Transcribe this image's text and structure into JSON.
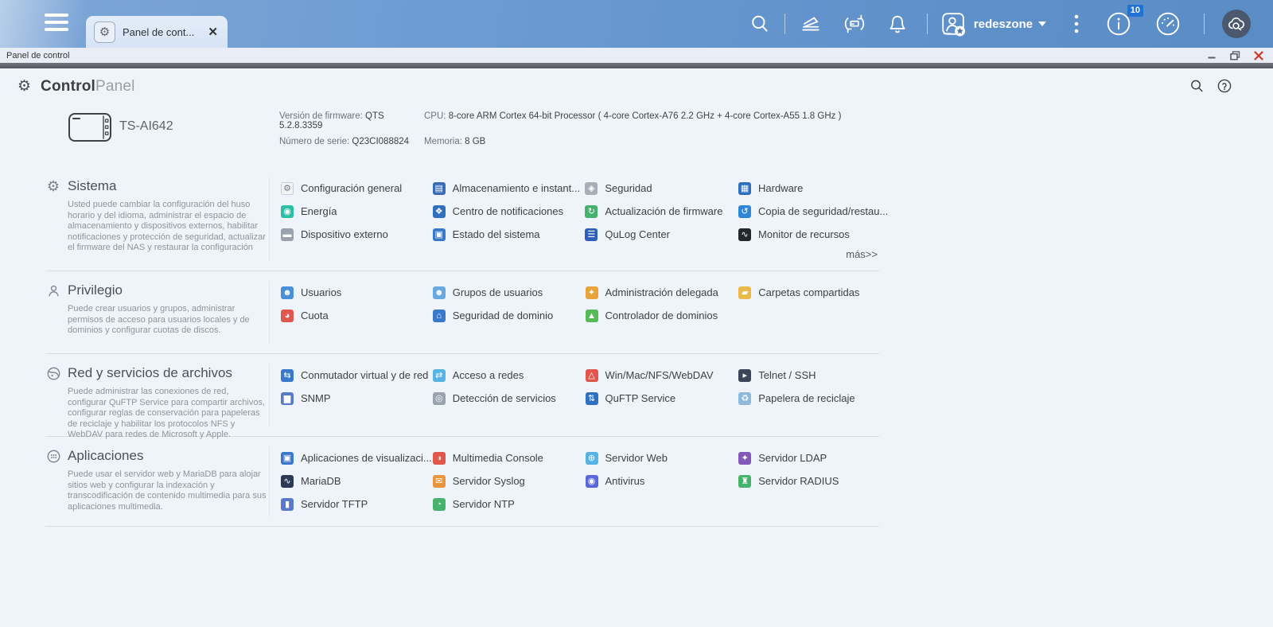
{
  "topbar": {
    "tab": {
      "label": "Panel de cont...",
      "icon": "gear-icon"
    },
    "user": {
      "name": "redeszone"
    },
    "info_badge": "10"
  },
  "window": {
    "title": "Panel de control"
  },
  "panel": {
    "title_bold": "Control",
    "title_light": "Panel"
  },
  "icons": {
    "gear_glyph": "⚙"
  },
  "device": {
    "model": "TS-AI642",
    "info": [
      {
        "label": "Versión de firmware:",
        "value": "QTS 5.2.8.3359"
      },
      {
        "label": "CPU:",
        "value": "8-core ARM Cortex 64-bit Processor ( 4-core Cortex-A76 2.2 GHz + 4-core Cortex-A55 1.8 GHz )"
      },
      {
        "label": "Número de serie:",
        "value": "Q23CI088824"
      },
      {
        "label": "Memoria:",
        "value": "8 GB"
      }
    ]
  },
  "sections": [
    {
      "id": "sistema",
      "title": "Sistema",
      "description": "Usted puede cambiar la configuración del huso horario y del idioma, administrar el espacio de almacenamiento y dispositivos externos, habilitar notificaciones y protección de seguridad, actualizar el firmware del NAS y restaurar la configuración",
      "more_label": "más>>",
      "columns": [
        [
          {
            "label": "Configuración general",
            "name": "link-configuracion-general",
            "icon": "general-settings-icon",
            "glyph": "⚙",
            "color": "#f2f4f6",
            "fg": "#6e7884",
            "bd": "#c6ccd4"
          },
          {
            "label": "Energía",
            "name": "link-energia",
            "icon": "power-bulb-icon",
            "glyph": "◉",
            "color": "#2dbfa4"
          },
          {
            "label": "Dispositivo externo",
            "name": "link-dispositivo-externo",
            "icon": "external-drive-icon",
            "glyph": "▬",
            "color": "#9aa3ad"
          }
        ],
        [
          {
            "label": "Almacenamiento e instant...",
            "name": "link-almacenamiento-instantaneas",
            "icon": "storage-snapshots-icon",
            "glyph": "▤",
            "color": "#3a6cb5"
          },
          {
            "label": "Centro de notificaciones",
            "name": "link-centro-notificaciones",
            "icon": "notification-center-icon",
            "glyph": "❖",
            "color": "#2f6fc0"
          },
          {
            "label": "Estado del sistema",
            "name": "link-estado-sistema",
            "icon": "system-status-icon",
            "glyph": "▣",
            "color": "#3a78c9"
          }
        ],
        [
          {
            "label": "Seguridad",
            "name": "link-seguridad",
            "icon": "security-lock-icon",
            "glyph": "◈",
            "color": "#a8aeb8"
          },
          {
            "label": "Actualización de firmware",
            "name": "link-actualizacion-firmware",
            "icon": "firmware-update-icon",
            "glyph": "↻",
            "color": "#45b36b"
          },
          {
            "label": "QuLog Center",
            "name": "link-qulog-center",
            "icon": "qulog-center-icon",
            "glyph": "☰",
            "color": "#2e5fb8"
          }
        ],
        [
          {
            "label": "Hardware",
            "name": "link-hardware",
            "icon": "hardware-chip-icon",
            "glyph": "▦",
            "color": "#2e6fbe"
          },
          {
            "label": "Copia de seguridad/restau...",
            "name": "link-copia-seguridad",
            "icon": "backup-restore-icon",
            "glyph": "↺",
            "color": "#2f86d6"
          },
          {
            "label": "Monitor de recursos",
            "name": "link-monitor-recursos",
            "icon": "resource-monitor-icon",
            "glyph": "∿",
            "color": "#23272e"
          }
        ]
      ]
    },
    {
      "id": "privilegio",
      "title": "Privilegio",
      "description": "Puede crear usuarios y grupos, administrar permisos de acceso para usuarios locales y de dominios y configurar cuotas de discos.",
      "columns": [
        [
          {
            "label": "Usuarios",
            "name": "link-usuarios",
            "icon": "user-icon",
            "glyph": "☻",
            "color": "#4a90d9"
          },
          {
            "label": "Cuota",
            "name": "link-cuota",
            "icon": "quota-pie-icon",
            "glyph": "◕",
            "color": "#e2574c"
          }
        ],
        [
          {
            "label": "Grupos de usuarios",
            "name": "link-grupos-usuarios",
            "icon": "user-groups-icon",
            "glyph": "☻",
            "color": "#6aa9e0"
          },
          {
            "label": "Seguridad de dominio",
            "name": "link-seguridad-dominio",
            "icon": "domain-security-icon",
            "glyph": "⌂",
            "color": "#3a78c9"
          }
        ],
        [
          {
            "label": "Administración delegada",
            "name": "link-administracion-delegada",
            "icon": "delegated-admin-icon",
            "glyph": "✦",
            "color": "#e8a33d"
          },
          {
            "label": "Controlador de dominios",
            "name": "link-controlador-dominios",
            "icon": "domain-controller-icon",
            "glyph": "▲",
            "color": "#58b957"
          }
        ],
        [
          {
            "label": "Carpetas compartidas",
            "name": "link-carpetas-compartidas",
            "icon": "shared-folders-icon",
            "glyph": "▰",
            "color": "#e9b949"
          }
        ]
      ]
    },
    {
      "id": "red-servicios",
      "title": "Red y servicios de archivos",
      "description": "Puede administrar las conexiones de red, configurar QuFTP Service para compartir archivos, configurar reglas de conservación para papeleras de reciclaje y habilitar los protocolos NFS y WebDAV para redes de Microsoft y Apple.",
      "columns": [
        [
          {
            "label": "Conmutador virtual y de red",
            "name": "link-conmutador-virtual",
            "icon": "virtual-switch-icon",
            "glyph": "⇆",
            "color": "#3a78c9"
          },
          {
            "label": "SNMP",
            "name": "link-snmp",
            "icon": "snmp-chart-icon",
            "glyph": "▆",
            "color": "#5b79c9"
          }
        ],
        [
          {
            "label": "Acceso a redes",
            "name": "link-acceso-redes",
            "icon": "network-access-icon",
            "glyph": "⇄",
            "color": "#57b3e3"
          },
          {
            "label": "Detección de servicios",
            "name": "link-deteccion-servicios",
            "icon": "service-discovery-icon",
            "glyph": "◎",
            "color": "#9aa3ad"
          }
        ],
        [
          {
            "label": "Win/Mac/NFS/WebDAV",
            "name": "link-win-mac-nfs-webdav",
            "icon": "protocols-icon",
            "glyph": "△",
            "color": "#e2574c"
          },
          {
            "label": "QuFTP Service",
            "name": "link-quftp-service",
            "icon": "quftp-icon",
            "glyph": "⇅",
            "color": "#2f6fc0"
          }
        ],
        [
          {
            "label": "Telnet / SSH",
            "name": "link-telnet-ssh",
            "icon": "terminal-icon",
            "glyph": "▸",
            "color": "#3b4757"
          },
          {
            "label": "Papelera de reciclaje",
            "name": "link-papelera-reciclaje",
            "icon": "recycle-bin-icon",
            "glyph": "♻",
            "color": "#8fb8dd"
          }
        ]
      ]
    },
    {
      "id": "aplicaciones",
      "title": "Aplicaciones",
      "description": "Puede usar el servidor web y MariaDB para alojar sitios web y configurar la indexación y transcodificación de contenido multimedia para sus aplicaciones multimedia.",
      "columns": [
        [
          {
            "label": "Aplicaciones de visualizaci...",
            "name": "link-aplicaciones-visualizacion",
            "icon": "display-apps-icon",
            "glyph": "▣",
            "color": "#3a78c9"
          },
          {
            "label": "MariaDB",
            "name": "link-mariadb",
            "icon": "mariadb-icon",
            "glyph": "∿",
            "color": "#2b3a55"
          },
          {
            "label": "Servidor TFTP",
            "name": "link-servidor-tftp",
            "icon": "tftp-server-icon",
            "glyph": "▮",
            "color": "#5b79c9"
          }
        ],
        [
          {
            "label": "Multimedia Console",
            "name": "link-multimedia-console",
            "icon": "multimedia-console-icon",
            "glyph": "◑",
            "color": "#e2574c"
          },
          {
            "label": "Servidor Syslog",
            "name": "link-servidor-syslog",
            "icon": "syslog-server-icon",
            "glyph": "✉",
            "color": "#e8953d"
          },
          {
            "label": "Servidor NTP",
            "name": "link-servidor-ntp",
            "icon": "ntp-server-icon",
            "glyph": "◔",
            "color": "#45b36b"
          }
        ],
        [
          {
            "label": "Servidor Web",
            "name": "link-servidor-web",
            "icon": "web-server-icon",
            "glyph": "⊕",
            "color": "#57b3e3"
          },
          {
            "label": "Antivirus",
            "name": "link-antivirus",
            "icon": "antivirus-icon",
            "glyph": "◉",
            "color": "#5b67d8"
          }
        ],
        [
          {
            "label": "Servidor LDAP",
            "name": "link-servidor-ldap",
            "icon": "ldap-server-icon",
            "glyph": "✦",
            "color": "#8458b8"
          },
          {
            "label": "Servidor RADIUS",
            "name": "link-servidor-radius",
            "icon": "radius-server-icon",
            "glyph": "♜",
            "color": "#45b36b"
          }
        ]
      ]
    }
  ]
}
